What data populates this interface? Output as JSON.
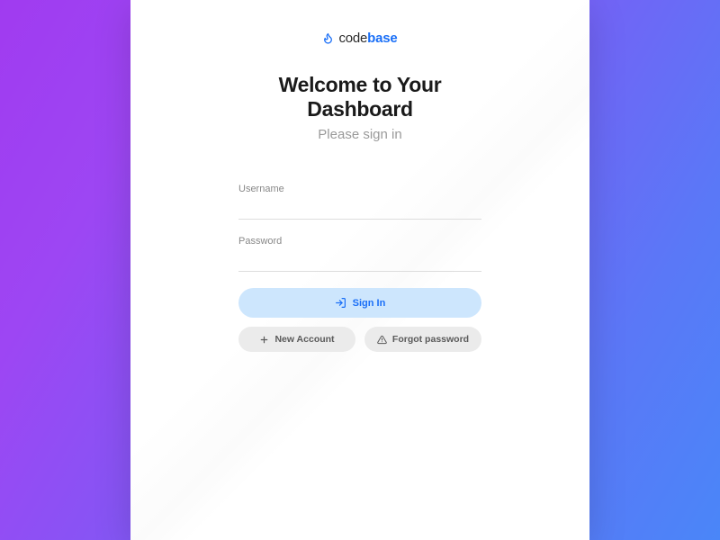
{
  "brand": {
    "prefix": "code",
    "suffix": "base"
  },
  "heading": "Welcome to Your Dashboard",
  "subheading": "Please sign in",
  "fields": {
    "username": {
      "label": "Username",
      "value": ""
    },
    "password": {
      "label": "Password",
      "value": ""
    }
  },
  "buttons": {
    "signin": "Sign In",
    "new_account": "New Account",
    "forgot": "Forgot password"
  },
  "colors": {
    "accent": "#1a6ff7",
    "primary_btn_bg": "#cde6fd",
    "secondary_btn_bg": "#ebebeb",
    "gradient_start": "#a03bf0",
    "gradient_end": "#4a86f8"
  }
}
